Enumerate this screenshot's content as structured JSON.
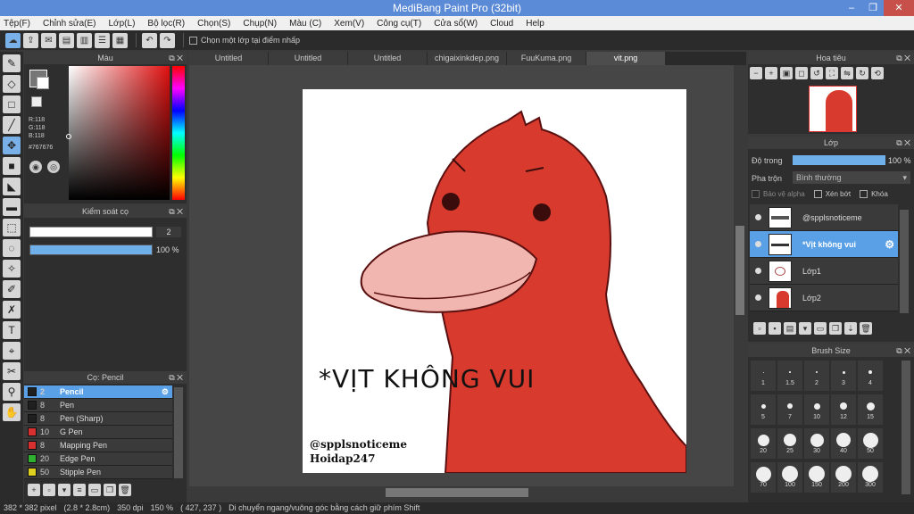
{
  "window": {
    "title": "MediBang Paint Pro (32bit)",
    "minimize": "–",
    "maximize": "❐",
    "close": "✕"
  },
  "menu": [
    "Tệp(F)",
    "Chỉnh sửa(E)",
    "Lớp(L)",
    "Bộ lọc(R)",
    "Chọn(S)",
    "Chụp(N)",
    "Màu (C)",
    "Xem(V)",
    "Công cụ(T)",
    "Cửa sổ(W)",
    "Cloud",
    "Help"
  ],
  "toolbar": {
    "select_layer_label": "Chọn một lớp tại điểm nhấp",
    "undo": "↶",
    "redo": "↷"
  },
  "color_panel": {
    "title": "Màu",
    "r": "R:118",
    "g": "G:118",
    "b": "B:118",
    "hex": "#767676"
  },
  "brush_control": {
    "title": "Kiểm soát cọ",
    "size": "2",
    "opacity": "100 %",
    "opacity_value": 100
  },
  "brush_list": {
    "title": "Cọ: Pencil",
    "items": [
      {
        "size": "2",
        "name": "Pencil",
        "color": "#202020"
      },
      {
        "size": "8",
        "name": "Pen",
        "color": "#202020"
      },
      {
        "size": "8",
        "name": "Pen (Sharp)",
        "color": "#202020"
      },
      {
        "size": "10",
        "name": "G Pen",
        "color": "#d83030"
      },
      {
        "size": "8",
        "name": "Mapping Pen",
        "color": "#d83030"
      },
      {
        "size": "20",
        "name": "Edge Pen",
        "color": "#30b030"
      },
      {
        "size": "50",
        "name": "Stipple Pen",
        "color": "#e0d020"
      }
    ]
  },
  "tabs": [
    "Untitled",
    "Untitled",
    "Untitled",
    "chigaixinkdep.png",
    "FuuKuma.png",
    "vit.png"
  ],
  "canvas": {
    "text_main": "*VỊT KHÔNG VUI",
    "credit1": "@spplsnoticeme",
    "credit2": "Hoidap247",
    "duck_color": "#d93a2e"
  },
  "navigator": {
    "title": "Hoa tiêu"
  },
  "layers": {
    "title": "Lớp",
    "opacity_label": "Độ trong",
    "opacity_value": "100 %",
    "blend_label": "Pha trộn",
    "blend_value": "Bình thường",
    "protect_alpha": "Bảo vệ alpha",
    "clipping": "Xén bớt",
    "lock": "Khóa",
    "items": [
      {
        "name": "@spplsnoticeme"
      },
      {
        "name": "*Vịt không vui"
      },
      {
        "name": "Lớp1"
      },
      {
        "name": "Lớp2"
      }
    ]
  },
  "brush_size": {
    "title": "Brush Size",
    "sizes": [
      "1",
      "1.5",
      "2",
      "3",
      "4",
      "5",
      "7",
      "10",
      "12",
      "15",
      "20",
      "25",
      "30",
      "40",
      "50",
      "70",
      "100",
      "150",
      "200",
      "300"
    ]
  },
  "status": {
    "dims": "382 * 382 pixel",
    "cm": "(2.8 * 2.8cm)",
    "dpi": "350 dpi",
    "zoom": "150 %",
    "coords": "( 427, 237 )",
    "hint": "Di chuyển ngang/vuông góc bằng cách giữ phím Shift"
  }
}
